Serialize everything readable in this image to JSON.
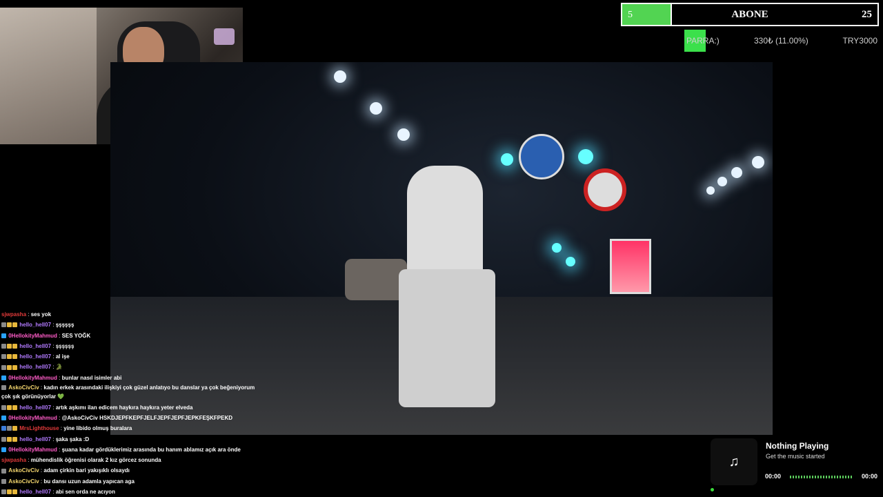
{
  "abone_goal": {
    "current": "5",
    "title": "ABONE",
    "target": "25",
    "progress": 0.19
  },
  "donation_goal": {
    "label": "PARRA:)",
    "amount": "330₺ (11.00%)",
    "goal": "TRY3000",
    "progress": 0.11
  },
  "chat": [
    {
      "user": "sjwpasha",
      "color": "#e33a3a",
      "badges": [],
      "text": "ses yok"
    },
    {
      "user": "hello_hell07",
      "color": "#b27aff",
      "badges": [
        "#8a8a8a",
        "#e8b83b",
        "#e8b83b"
      ],
      "text": "şşşşşş"
    },
    {
      "user": "0HellokityMahmud",
      "color": "#ff5cc8",
      "badges": [
        "#29a3ff"
      ],
      "text": "SES YOĞK"
    },
    {
      "user": "hello_hell07",
      "color": "#b27aff",
      "badges": [
        "#8a8a8a",
        "#e8b83b",
        "#e8b83b"
      ],
      "text": "şşşşşş"
    },
    {
      "user": "hello_hell07",
      "color": "#b27aff",
      "badges": [
        "#8a8a8a",
        "#e8b83b",
        "#e8b83b"
      ],
      "text": "al işe"
    },
    {
      "user": "hello_hell07",
      "color": "#b27aff",
      "badges": [
        "#8a8a8a",
        "#e8b83b",
        "#e8b83b"
      ],
      "text": "🐊"
    },
    {
      "user": "0HellokityMahmud",
      "color": "#ff5cc8",
      "badges": [
        "#29a3ff"
      ],
      "text": "bunlar nasıl isimler abi"
    },
    {
      "user": "AskoCivCiv",
      "color": "#f5d76e",
      "badges": [
        "#8a8a8a"
      ],
      "text": "kadın erkek arasındaki ilişkiyi çok güzel anlatıyo bu danslar ya çok beğeniyorum çok şık görünüyorlar 💚",
      "wrap": true
    },
    {
      "user": "hello_hell07",
      "color": "#b27aff",
      "badges": [
        "#8a8a8a",
        "#e8b83b",
        "#e8b83b"
      ],
      "text": "artık aşkımı ilan edicem haykıra haykıra yeter elveda"
    },
    {
      "user": "0HellokityMahmud",
      "color": "#ff5cc8",
      "badges": [
        "#29a3ff"
      ],
      "text": "@AskoCivCiv HSKDJEPFKEPFJELFJEPFJEPFJEPKFEŞKFPEKD"
    },
    {
      "user": "MrsLighthouse",
      "color": "#e33a3a",
      "badges": [
        "#3c7dd9",
        "#8a8a8a",
        "#e8b83b"
      ],
      "text": "yine libido olmuş buralara"
    },
    {
      "user": "hello_hell07",
      "color": "#b27aff",
      "badges": [
        "#8a8a8a",
        "#e8b83b",
        "#e8b83b"
      ],
      "text": "şaka şaka :D"
    },
    {
      "user": "0HellokityMahmud",
      "color": "#ff5cc8",
      "badges": [
        "#29a3ff"
      ],
      "text": "şuana kadar gördüklerimiz arasında bu hanım ablamız açık ara önde"
    },
    {
      "user": "sjwpasha",
      "color": "#e33a3a",
      "badges": [],
      "text": "mühendislik öğrenisi olarak 2 kız görcez sonunda"
    },
    {
      "user": "AskoCivCiv",
      "color": "#f5d76e",
      "badges": [
        "#8a8a8a"
      ],
      "text": "adam çirkin bari yakışıklı olsaydı"
    },
    {
      "user": "AskoCivCiv",
      "color": "#f5d76e",
      "badges": [
        "#8a8a8a"
      ],
      "text": "bu dansı uzun adamla yapıcan aga"
    },
    {
      "user": "hello_hell07",
      "color": "#b27aff",
      "badges": [
        "#8a8a8a",
        "#e8b83b",
        "#e8b83b"
      ],
      "text": "abi sen orda ne acıyon"
    }
  ],
  "music": {
    "icon": "music-note-icon",
    "track": "Nothing Playing",
    "artist": "Get the music started",
    "time_current": "00:00",
    "time_total": "00:00"
  }
}
